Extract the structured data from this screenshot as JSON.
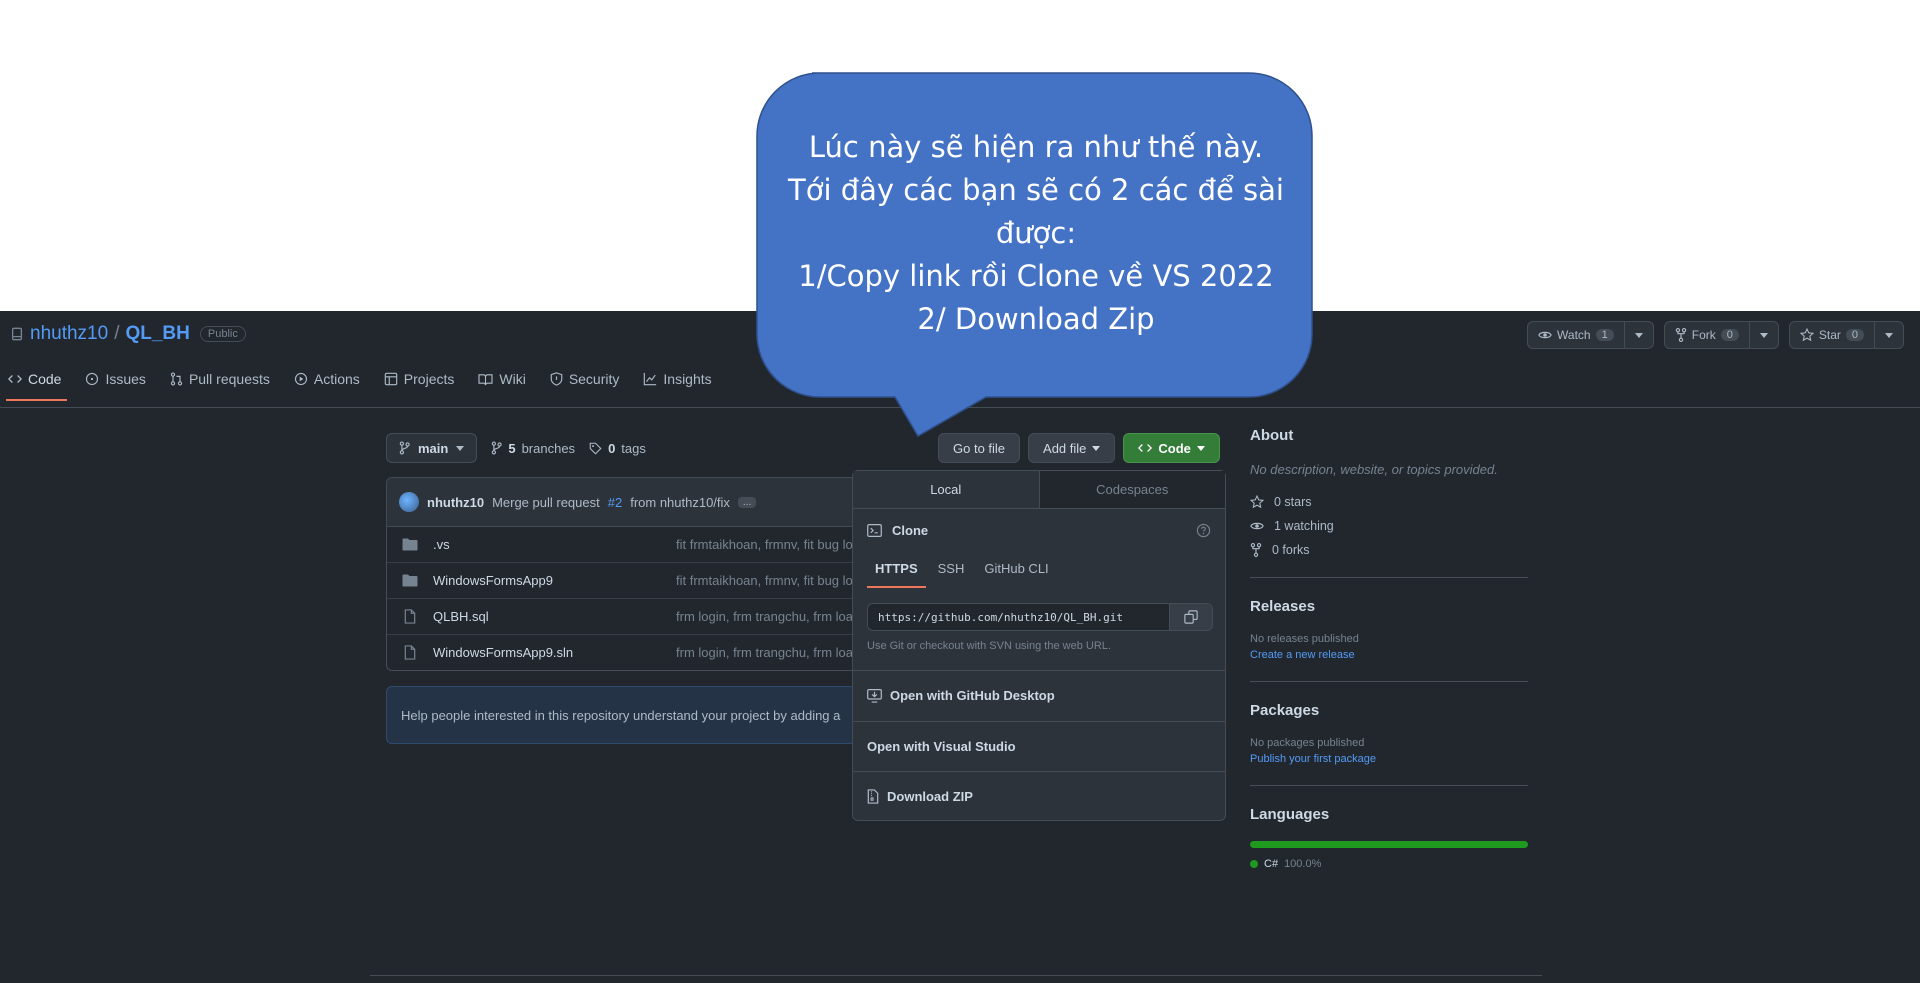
{
  "repo": {
    "owner": "nhuthz10",
    "separator": "/",
    "name": "QL_BH",
    "visibility": "Public"
  },
  "header_actions": [
    {
      "label": "Watch",
      "count": "1",
      "icon": "eye-icon"
    },
    {
      "label": "Fork",
      "count": "0",
      "icon": "fork-icon"
    },
    {
      "label": "Star",
      "count": "0",
      "icon": "star-icon"
    }
  ],
  "tabs": [
    {
      "label": "Code",
      "icon": "code-icon",
      "active": true
    },
    {
      "label": "Issues",
      "icon": "issue-icon"
    },
    {
      "label": "Pull requests",
      "icon": "pull-request-icon"
    },
    {
      "label": "Actions",
      "icon": "play-icon"
    },
    {
      "label": "Projects",
      "icon": "table-icon"
    },
    {
      "label": "Wiki",
      "icon": "book-icon"
    },
    {
      "label": "Security",
      "icon": "shield-icon"
    },
    {
      "label": "Insights",
      "icon": "graph-icon"
    }
  ],
  "branch": {
    "name": "main",
    "branches_count": "5",
    "branches_label": "branches",
    "tags_count": "0",
    "tags_label": "tags"
  },
  "file_buttons": {
    "go_to_file": "Go to file",
    "add_file": "Add file",
    "code": "Code"
  },
  "commit": {
    "author": "nhuthz10",
    "message_prefix": "Merge pull request",
    "pr": "#2",
    "message_suffix": "from nhuthz10/fix",
    "more": "..."
  },
  "files": [
    {
      "name": ".vs",
      "type": "folder",
      "message": "fit frmtaikhoan, frmnv, fit bug lo"
    },
    {
      "name": "WindowsFormsApp9",
      "type": "folder",
      "message": "fit frmtaikhoan, frmnv, fit bug lo"
    },
    {
      "name": "QLBH.sql",
      "type": "file",
      "message": "frm login, frm trangchu, frm loa"
    },
    {
      "name": "WindowsFormsApp9.sln",
      "type": "file",
      "message": "frm login, frm trangchu, frm loa"
    }
  ],
  "readme_banner": "Help people interested in this repository understand your project by adding a",
  "clone_panel": {
    "tabs": [
      "Local",
      "Codespaces"
    ],
    "title": "Clone",
    "protocols": [
      "HTTPS",
      "SSH",
      "GitHub CLI"
    ],
    "url": "https://github.com/nhuthz10/QL_BH.git",
    "hint": "Use Git or checkout with SVN using the web URL.",
    "open_desktop": "Open with GitHub Desktop",
    "open_vs": "Open with Visual Studio",
    "download_zip": "Download ZIP"
  },
  "about": {
    "title": "About",
    "description": "No description, website, or topics provided.",
    "stars": "0 stars",
    "watching": "1 watching",
    "forks": "0 forks"
  },
  "releases": {
    "title": "Releases",
    "empty": "No releases published",
    "link": "Create a new release"
  },
  "packages": {
    "title": "Packages",
    "empty": "No packages published",
    "link": "Publish your first package"
  },
  "languages": {
    "title": "Languages",
    "items": [
      {
        "name": "C#",
        "percent": "100.0%",
        "color": "#1e9a1e"
      }
    ]
  },
  "callout": {
    "lines": [
      "Lúc này sẽ hiện ra như thế này.",
      "Tới đây các bạn sẽ có 2 các để sài",
      "được:",
      "1/Copy link rồi Clone về VS 2022",
      "2/ Download Zip"
    ],
    "fill": "#4472c4",
    "stroke": "#2f528f"
  },
  "colors": {
    "background": "#22272e",
    "accent_link": "#539bf5",
    "primary_button": "#347d39",
    "tab_underline": "#ec775c"
  }
}
